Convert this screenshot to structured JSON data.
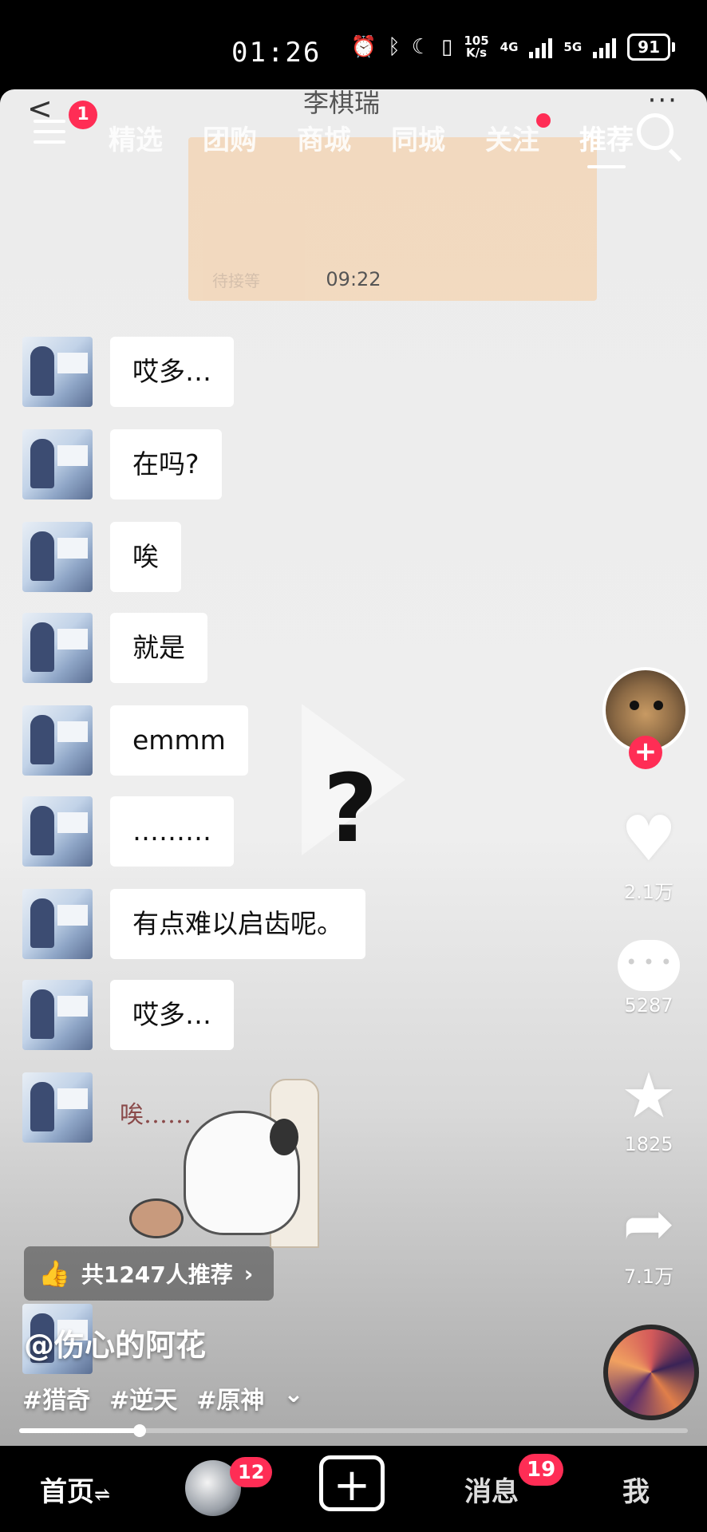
{
  "status_bar": {
    "time": "01:26",
    "net_speed_top": "105",
    "net_speed_bottom": "K/s",
    "signal1": "4G",
    "signal2": "5G",
    "battery": "91"
  },
  "chat_header": {
    "title": "李棋瑞",
    "back": "<",
    "more": "···",
    "ghost_text": "待接等"
  },
  "top_nav": {
    "menu_badge": "1",
    "tabs": [
      "精选",
      "团购",
      "商城",
      "同城",
      "关注",
      "推荐"
    ],
    "active_tab": "推荐"
  },
  "chat": {
    "timestamp": "09:22",
    "messages": [
      "哎多…",
      "在吗?",
      "唉",
      "就是",
      "emmm",
      "………",
      "有点难以启齿呢。",
      "哎多…"
    ],
    "sticker_text": "唉……",
    "overlay_symbol": "?"
  },
  "right_rail": {
    "follow": "+",
    "likes": "2.1万",
    "comments": "5287",
    "favorites": "1825",
    "shares": "7.1万"
  },
  "video_info": {
    "recommend": "共1247人推荐",
    "author": "@伤心的阿花",
    "tags": [
      "#猎奇",
      "#逆天",
      "#原神"
    ],
    "progress": 0.18
  },
  "bottom_nav": {
    "home": "首页",
    "home_suffix": "⇌",
    "friend_badge": "12",
    "plus": "+",
    "messages": "消息",
    "messages_badge": "19",
    "me": "我"
  },
  "colors": {
    "accent": "#ff2d55",
    "bubble": "#ffffff",
    "background": "#ececec"
  }
}
